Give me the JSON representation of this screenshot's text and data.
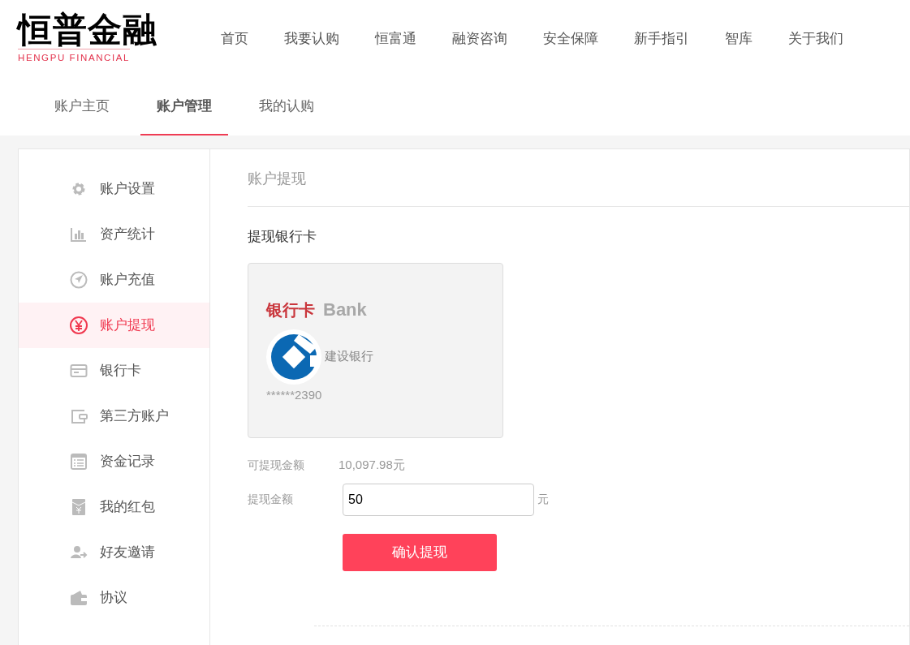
{
  "logo": {
    "name": "恒普金融",
    "subtitle": "HENGPU FINANCIAL"
  },
  "nav": [
    "首页",
    "我要认购",
    "恒富通",
    "融资咨询",
    "安全保障",
    "新手指引",
    "智库",
    "关于我们"
  ],
  "tabs": [
    {
      "label": "账户主页",
      "selected": false
    },
    {
      "label": "账户管理",
      "selected": true
    },
    {
      "label": "我的认购",
      "selected": false
    }
  ],
  "sidebar": {
    "items": [
      {
        "label": "账户设置",
        "selected": false
      },
      {
        "label": "资产统计",
        "selected": false
      },
      {
        "label": "账户充值",
        "selected": false
      },
      {
        "label": "账户提现",
        "selected": true
      },
      {
        "label": "银行卡",
        "selected": false
      },
      {
        "label": "第三方账户",
        "selected": false
      },
      {
        "label": "资金记录",
        "selected": false
      },
      {
        "label": "我的红包",
        "selected": false
      },
      {
        "label": "好友邀请",
        "selected": false
      },
      {
        "label": "协议",
        "selected": false
      }
    ]
  },
  "main": {
    "title": "账户提现",
    "section": "提现银行卡",
    "card": {
      "title": "银行卡",
      "title_en": "Bank",
      "bank": "建设银行",
      "number": "******2390"
    },
    "available_label": "可提现金额",
    "available_value": "10,097.98元",
    "amount_label": "提现金额",
    "amount_value": "50",
    "amount_unit": "元",
    "submit": "确认提现"
  }
}
